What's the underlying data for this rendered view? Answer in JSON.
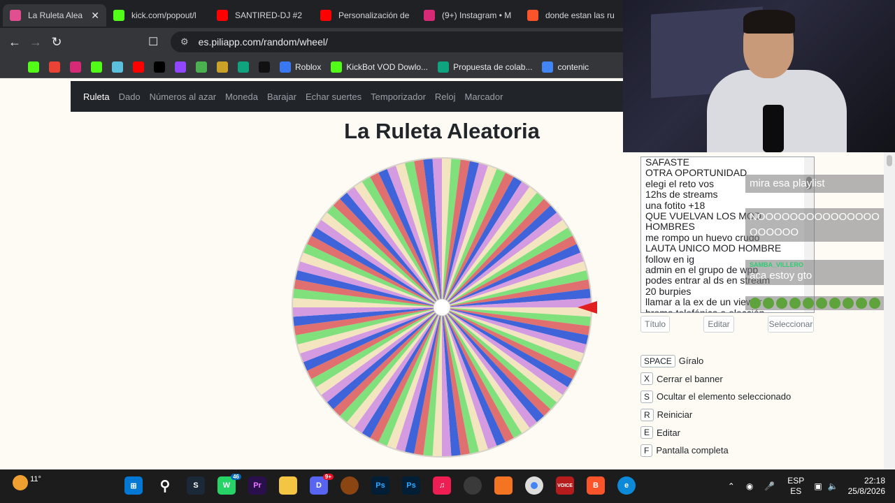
{
  "browser": {
    "tabs": [
      {
        "title": "La Ruleta Alea",
        "active": true,
        "favicon": "wheel-favicon",
        "color": "#e04f8f"
      },
      {
        "title": "kick.com/popout/l",
        "active": false,
        "favicon": "kick-favicon",
        "color": "#53fc18"
      },
      {
        "title": "SANTIRED-DJ #2",
        "active": false,
        "favicon": "youtube-favicon",
        "color": "#ff0000"
      },
      {
        "title": "Personalización de",
        "active": false,
        "favicon": "youtube-favicon",
        "color": "#ff0000"
      },
      {
        "title": "(9+) Instagram • M",
        "active": false,
        "favicon": "instagram-favicon",
        "color": "#d62976"
      },
      {
        "title": "donde estan las ru",
        "active": false,
        "favicon": "brave-favicon",
        "color": "#fb542b"
      }
    ],
    "url": "es.piliapp.com/random/wheel/",
    "bookmarks": [
      {
        "label": "",
        "icon": "apps-icon",
        "color": "#35363a"
      },
      {
        "label": "",
        "icon": "kick-icon",
        "color": "#53fc18"
      },
      {
        "label": "",
        "icon": "gmail-icon",
        "color": "#ea4335"
      },
      {
        "label": "",
        "icon": "instagram-icon",
        "color": "#d62976"
      },
      {
        "label": "",
        "icon": "kick-icon",
        "color": "#53fc18"
      },
      {
        "label": "",
        "icon": "gem-icon",
        "color": "#5bc0de"
      },
      {
        "label": "",
        "icon": "youtube-icon",
        "color": "#ff0000"
      },
      {
        "label": "",
        "icon": "x-icon",
        "color": "#000000"
      },
      {
        "label": "",
        "icon": "twitch-icon",
        "color": "#9146ff"
      },
      {
        "label": "",
        "icon": "maps-icon",
        "color": "#4caf50"
      },
      {
        "label": "",
        "icon": "eye-icon",
        "color": "#c9a227"
      },
      {
        "label": "",
        "icon": "chatgpt-icon",
        "color": "#10a37f"
      },
      {
        "label": "",
        "icon": "tiktok-icon",
        "color": "#111111"
      },
      {
        "label": "Roblox",
        "icon": "roblox-icon",
        "color": "#3a78f2"
      },
      {
        "label": "KickBot VOD Dowlo...",
        "icon": "kickbot-icon",
        "color": "#53fc18"
      },
      {
        "label": "Propuesta de colab...",
        "icon": "chatgpt-icon",
        "color": "#10a37f"
      },
      {
        "label": "contenic",
        "icon": "docs-icon",
        "color": "#4285f4"
      }
    ]
  },
  "site": {
    "nav": [
      "Ruleta",
      "Dado",
      "Números al azar",
      "Moneda",
      "Barajar",
      "Echar suertes",
      "Temporizador",
      "Reloj",
      "Marcador"
    ],
    "title": "La Ruleta Aleatoria"
  },
  "wheel": {
    "segment_colors": [
      "#f2e5c0",
      "#7fe07c",
      "#e06f6f",
      "#3f63d8",
      "#d49be0"
    ],
    "segment_count": 100
  },
  "options": [
    "SAFASTE",
    "OTRA OPORTUNIDAD",
    "elegi el reto vos",
    "12hs de streams",
    "una fotito +18",
    "QUE VUELVAN LOS MOD",
    "HOMBRES",
    "me rompo un huevo crudo",
    "LAUTA UNICO MOD HOMBRE",
    "follow en ig",
    "admin en el grupo de wpp",
    "podes entrar al ds en stream",
    "20 burpies",
    "llamar a la ex de un viewer",
    "broma telefónica a elección"
  ],
  "buttons": {
    "titulo": "Título",
    "editar": "Editar",
    "seleccionar": "Seleccionar"
  },
  "shortcuts": [
    {
      "key": "SPACE",
      "label": "Gíralo"
    },
    {
      "key": "X",
      "label": "Cerrar el banner"
    },
    {
      "key": "S",
      "label": "Ocultar el elemento seleccionado"
    },
    {
      "key": "R",
      "label": "Reiniciar"
    },
    {
      "key": "E",
      "label": "Editar"
    },
    {
      "key": "F",
      "label": "Pantalla completa"
    }
  ],
  "chat": [
    {
      "user": "",
      "msg": "mira esa playlist",
      "color": "#2ecc71"
    },
    {
      "user": "",
      "msg": "NOOOOOOOOOOOOOOOOOOOOO",
      "color": "#e67e22"
    },
    {
      "user": "SAMBA_VILLERO",
      "msg": "aca estoy gto",
      "color": "#2ecc71"
    },
    {
      "user": "",
      "msg": "",
      "color": "#e67e22"
    }
  ],
  "taskbar": {
    "weather": "11°",
    "whatsapp_badge": "46",
    "discord_badge": "9+",
    "lang_top": "ESP",
    "lang_bottom": "ES",
    "time": "22:18",
    "date": "25/8/2026"
  }
}
